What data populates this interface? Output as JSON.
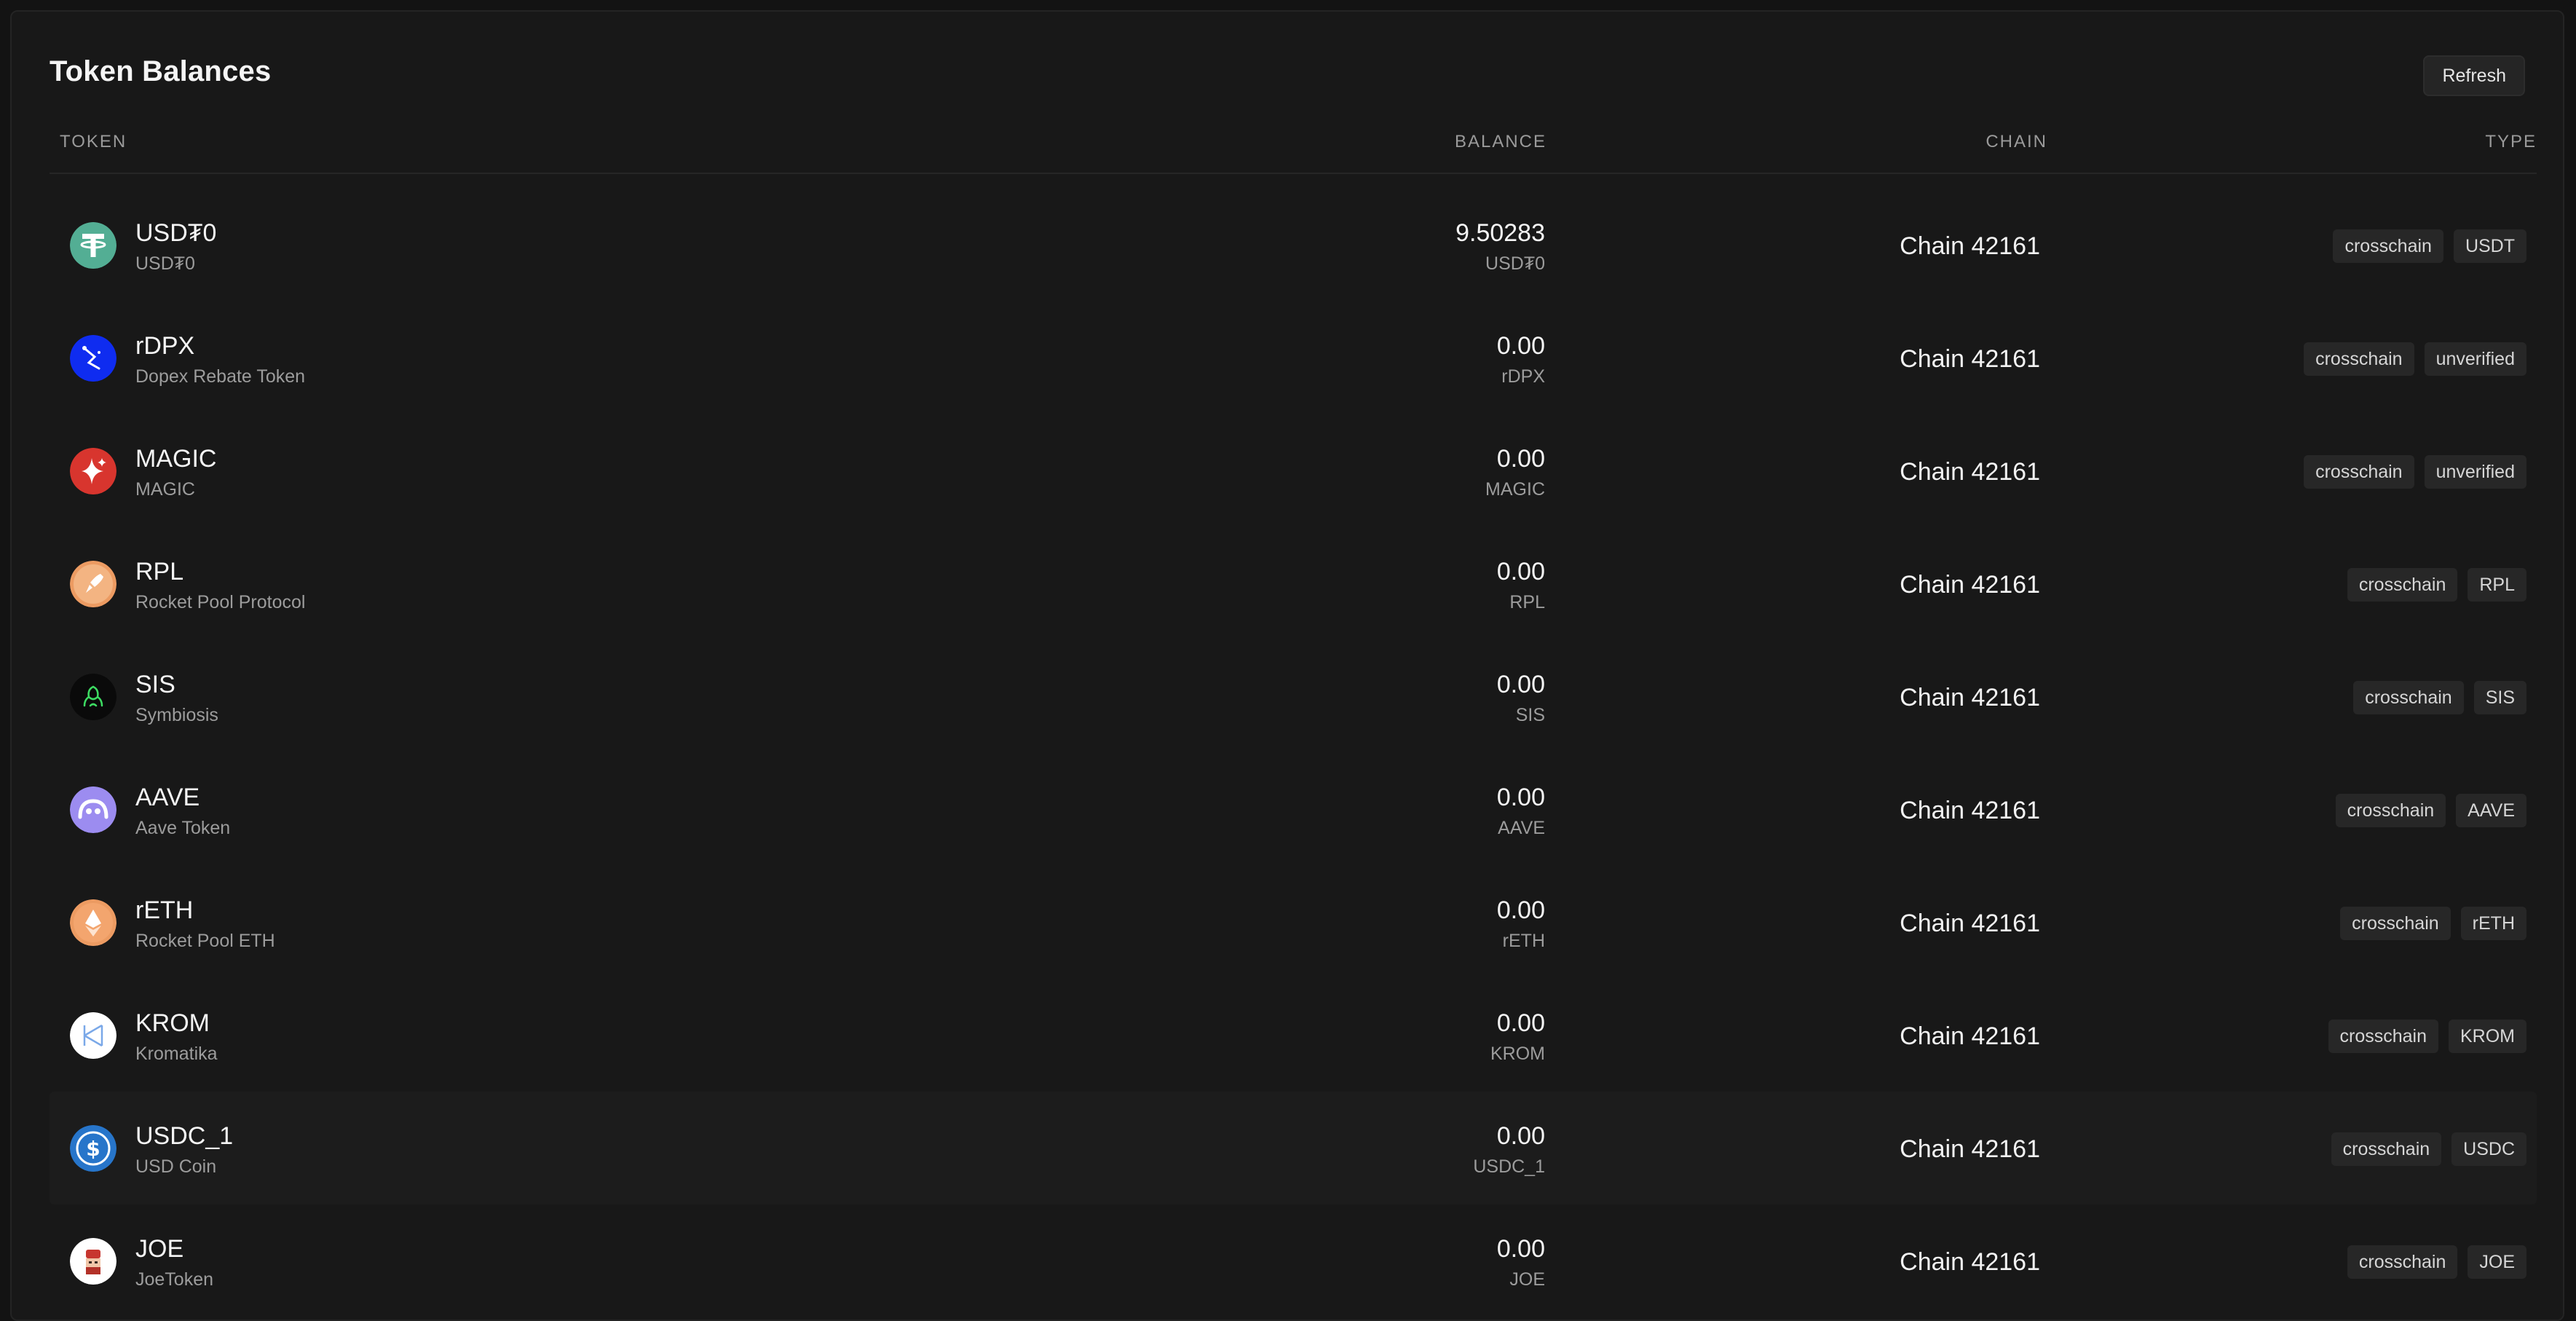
{
  "header": {
    "title": "Token Balances",
    "refresh_label": "Refresh"
  },
  "columns": {
    "token": "TOKEN",
    "balance": "BALANCE",
    "chain": "CHAIN",
    "type": "TYPE"
  },
  "colors": {
    "background": "#131313",
    "panel": "#181818",
    "badge": "#272727",
    "muted_text": "#9c9c9c"
  },
  "tokens": [
    {
      "symbol": "USD₮0",
      "name": "USD₮0",
      "balance": "9.50283",
      "balance_symbol": "USD₮0",
      "chain": "Chain 42161",
      "tags": [
        "crosschain",
        "USDT"
      ],
      "icon": "tether-icon"
    },
    {
      "symbol": "rDPX",
      "name": "Dopex Rebate Token",
      "balance": "0.00",
      "balance_symbol": "rDPX",
      "chain": "Chain 42161",
      "tags": [
        "crosschain",
        "unverified"
      ],
      "icon": "rdpx-icon"
    },
    {
      "symbol": "MAGIC",
      "name": "MAGIC",
      "balance": "0.00",
      "balance_symbol": "MAGIC",
      "chain": "Chain 42161",
      "tags": [
        "crosschain",
        "unverified"
      ],
      "icon": "magic-icon"
    },
    {
      "symbol": "RPL",
      "name": "Rocket Pool Protocol",
      "balance": "0.00",
      "balance_symbol": "RPL",
      "chain": "Chain 42161",
      "tags": [
        "crosschain",
        "RPL"
      ],
      "icon": "rocket-icon"
    },
    {
      "symbol": "SIS",
      "name": "Symbiosis",
      "balance": "0.00",
      "balance_symbol": "SIS",
      "chain": "Chain 42161",
      "tags": [
        "crosschain",
        "SIS"
      ],
      "icon": "symbiosis-icon"
    },
    {
      "symbol": "AAVE",
      "name": "Aave Token",
      "balance": "0.00",
      "balance_symbol": "AAVE",
      "chain": "Chain 42161",
      "tags": [
        "crosschain",
        "AAVE"
      ],
      "icon": "aave-icon"
    },
    {
      "symbol": "rETH",
      "name": "Rocket Pool ETH",
      "balance": "0.00",
      "balance_symbol": "rETH",
      "chain": "Chain 42161",
      "tags": [
        "crosschain",
        "rETH"
      ],
      "icon": "reth-icon"
    },
    {
      "symbol": "KROM",
      "name": "Kromatika",
      "balance": "0.00",
      "balance_symbol": "KROM",
      "chain": "Chain 42161",
      "tags": [
        "crosschain",
        "KROM"
      ],
      "icon": "krom-icon"
    },
    {
      "symbol": "USDC_1",
      "name": "USD Coin",
      "balance": "0.00",
      "balance_symbol": "USDC_1",
      "chain": "Chain 42161",
      "tags": [
        "crosschain",
        "USDC"
      ],
      "icon": "usdc-icon"
    },
    {
      "symbol": "JOE",
      "name": "JoeToken",
      "balance": "0.00",
      "balance_symbol": "JOE",
      "chain": "Chain 42161",
      "tags": [
        "crosschain",
        "JOE"
      ],
      "icon": "joe-icon"
    }
  ]
}
